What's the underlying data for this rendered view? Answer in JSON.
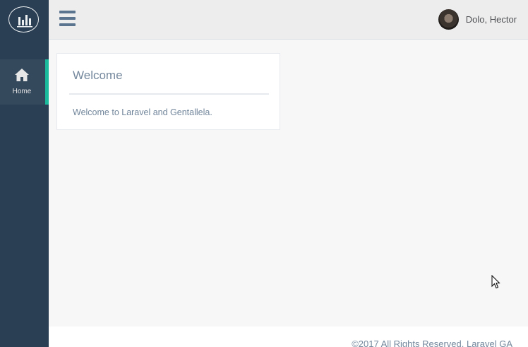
{
  "sidebar": {
    "logo_icon": "bar-chart-icon",
    "items": [
      {
        "label": "Home",
        "icon": "home-icon",
        "active": true
      }
    ],
    "colors": {
      "background": "#2A3F54",
      "active_bg": "#35495D",
      "active_accent": "#1ABB9C"
    }
  },
  "topbar": {
    "menu_icon": "hamburger-icon",
    "user_name": "Dolo, Hector",
    "avatar": "user-avatar"
  },
  "panel": {
    "title": "Welcome",
    "body": "Welcome to Laravel and Gentallela."
  },
  "footer": {
    "text": "©2017 All Rights Reserved. Laravel GA"
  },
  "colors": {
    "page_bg": "#F7F7F7",
    "text_muted": "#73879C"
  }
}
